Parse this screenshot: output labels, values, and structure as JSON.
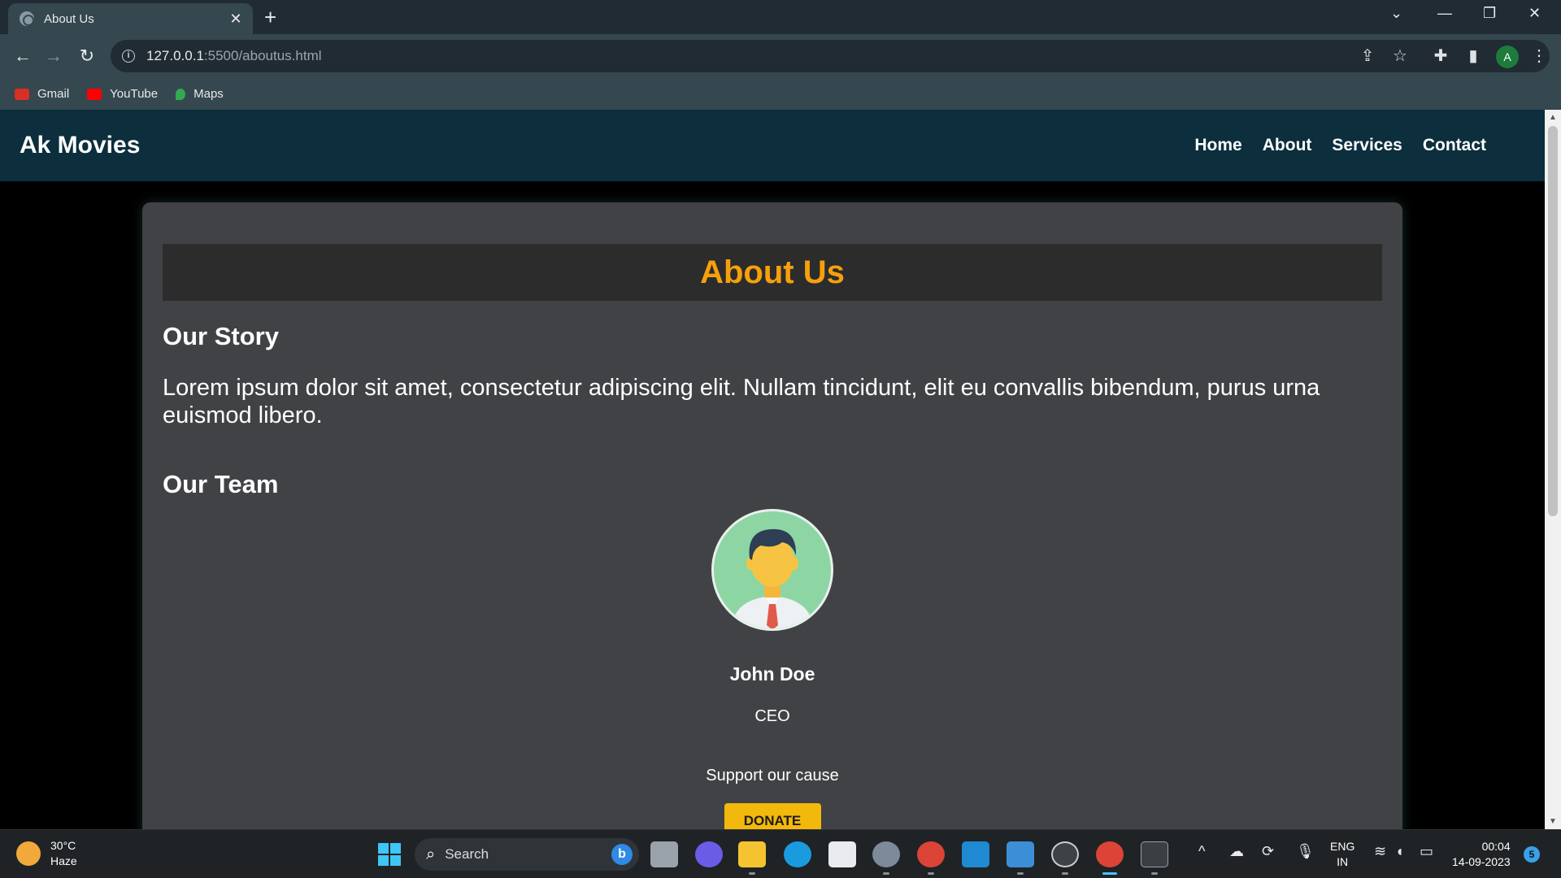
{
  "browser": {
    "tab_title": "About Us",
    "tab_close": "✕",
    "new_tab": "+",
    "url_host": "127.0.0.1",
    "url_path": ":5500/aboutus.html",
    "bookmarks": [
      {
        "label": "Gmail",
        "color": "#d93025"
      },
      {
        "label": "YouTube",
        "color": "#ff0000"
      },
      {
        "label": "Maps",
        "color": "#34a853"
      }
    ],
    "profile_initial": "A"
  },
  "site": {
    "logo": "Ak Movies",
    "nav": [
      "Home",
      "About",
      "Services",
      "Contact"
    ]
  },
  "about": {
    "title": "About Us",
    "story_heading": "Our Story",
    "story_text": "Lorem ipsum dolor sit amet, consectetur adipiscing elit. Nullam tincidunt, elit eu convallis bibendum, purus urna euismod libero.",
    "team_heading": "Our Team",
    "member": {
      "name": "John Doe",
      "role": "CEO"
    },
    "support_text": "Support our cause",
    "donate_label": "DONATE"
  },
  "taskbar": {
    "temperature": "30°C",
    "weather": "Haze",
    "search_placeholder": "Search",
    "lang_1": "ENG",
    "lang_2": "IN",
    "time": "00:04",
    "date": "14-09-2023",
    "notifications": "5"
  },
  "colors": {
    "header_bg": "#0c2e3d",
    "card_bg": "#414245",
    "accent": "#f5a00c",
    "donate": "#f3b80c"
  }
}
